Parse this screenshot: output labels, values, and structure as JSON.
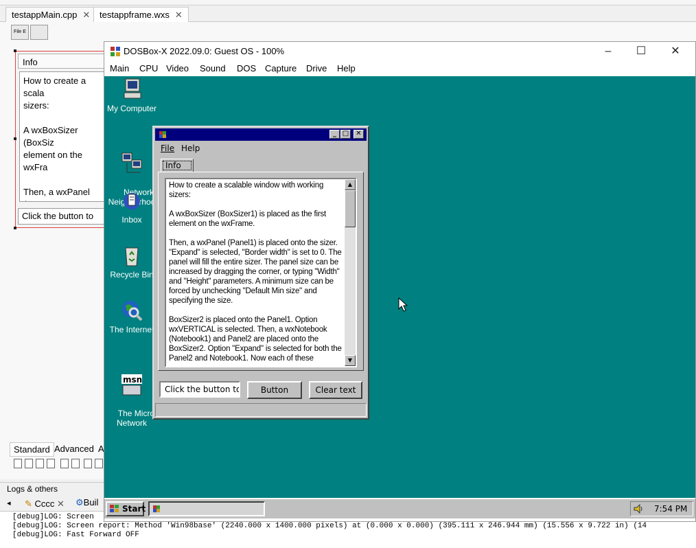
{
  "ide": {
    "tabs": [
      {
        "label": "testappMain.cpp"
      },
      {
        "label": "testappframe.wxs"
      }
    ],
    "toolbar": {
      "file_btn_label": "File E"
    },
    "designer": {
      "info_tab": "Info",
      "text": "How to create a scala\nsizers:\n\nA wxBoxSizer (BoxSiz\nelement on the wxFra\n\nThen, a wxPanel (Pan\n\"Expand\" is selected,\npanel will fill the enti\nincreased by draggin",
      "input_value": "Click the button to"
    },
    "palette": {
      "tabs": [
        "Standard",
        "Advanced",
        "A"
      ]
    },
    "logs": {
      "title": "Logs & others",
      "tabs": [
        "Cccc",
        "Buil"
      ],
      "lines": [
        "[debug]LOG: Screen",
        "[debug]LOG: Screen report: Method 'Win98base' (2240.000 x 1400.000 pixels) at (0.000 x 0.000) (395.111 x 246.944 mm) (15.556 x 9.722 in) (14",
        "[debug]LOG: Fast Forward OFF"
      ]
    }
  },
  "dosbox": {
    "title": "DOSBox-X 2022.09.0: Guest OS - 100%",
    "menu": [
      "Main",
      "CPU",
      "Video",
      "Sound",
      "DOS",
      "Capture",
      "Drive",
      "Help"
    ],
    "desktop_icons": [
      {
        "label": "My Computer",
        "icon": "computer-icon"
      },
      {
        "label": "Network\nNeighborhoo",
        "icon": "network-icon"
      },
      {
        "label": "Inbox",
        "icon": "inbox-icon"
      },
      {
        "label": "Recycle Bin",
        "icon": "recycle-bin-icon"
      },
      {
        "label": "The Internet",
        "icon": "internet-icon"
      },
      {
        "label": "The Microsof\nNetwork",
        "icon": "msn-icon"
      }
    ],
    "app": {
      "menu": [
        "File",
        "Help"
      ],
      "tab": "Info",
      "text": "How to create a scalable window with working sizers:\n\nA wxBoxSizer (BoxSizer1) is placed as the first element on the wxFrame.\n\nThen, a wxPanel (Panel1) is placed onto the sizer. \"Expand\" is selected, \"Border width\" is set to 0. The panel will fill the entire sizer. The panel size can be increased by dragging the corner, or typing \"Width\" and \"Height\" parameters. A minimum size can be forced by unchecking \"Default Min size\" and specifying the size.\n\nBoxSizer2 is placed onto the Panel1. Option wxVERTICAL is selected. Then, a wxNotebook (Notebook1) and Panel2 are placed onto the BoxSizer2. Option \"Expand\" is selected for both the Panel2 and Notebook1. Now each of these",
      "input_value": "Click the button to",
      "button_label": "Button",
      "clear_label": "Clear text"
    },
    "taskbar": {
      "start_label": "Start",
      "clock": "7:54 PM"
    },
    "colors": {
      "desktop": "#008080",
      "titlebar": "#00007f"
    }
  }
}
